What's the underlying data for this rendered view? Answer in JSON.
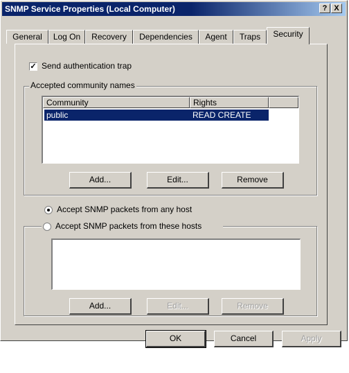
{
  "window": {
    "title": "SNMP Service Properties (Local Computer)",
    "help_label": "?",
    "close_label": "X"
  },
  "tabs": [
    {
      "label": "General"
    },
    {
      "label": "Log On"
    },
    {
      "label": "Recovery"
    },
    {
      "label": "Dependencies"
    },
    {
      "label": "Agent"
    },
    {
      "label": "Traps"
    },
    {
      "label": "Security"
    }
  ],
  "security": {
    "send_trap_label": "Send authentication trap",
    "send_trap_checked": true,
    "community_group_label": "Accepted community names",
    "columns": [
      "Community",
      "Rights"
    ],
    "rows": [
      {
        "community": "public",
        "rights": "READ CREATE"
      }
    ],
    "add_label": "Add...",
    "edit_label": "Edit...",
    "remove_label": "Remove",
    "radio_any_label": "Accept SNMP packets from any host",
    "radio_these_label": "Accept SNMP packets from these hosts",
    "selected_radio": "any",
    "hosts_add_label": "Add...",
    "hosts_edit_label": "Edit...",
    "hosts_remove_label": "Remove"
  },
  "footer": {
    "ok_label": "OK",
    "cancel_label": "Cancel",
    "apply_label": "Apply"
  },
  "colors": {
    "titlebar": "#0a246a",
    "face": "#d4d0c8",
    "selection": "#0a246a"
  }
}
